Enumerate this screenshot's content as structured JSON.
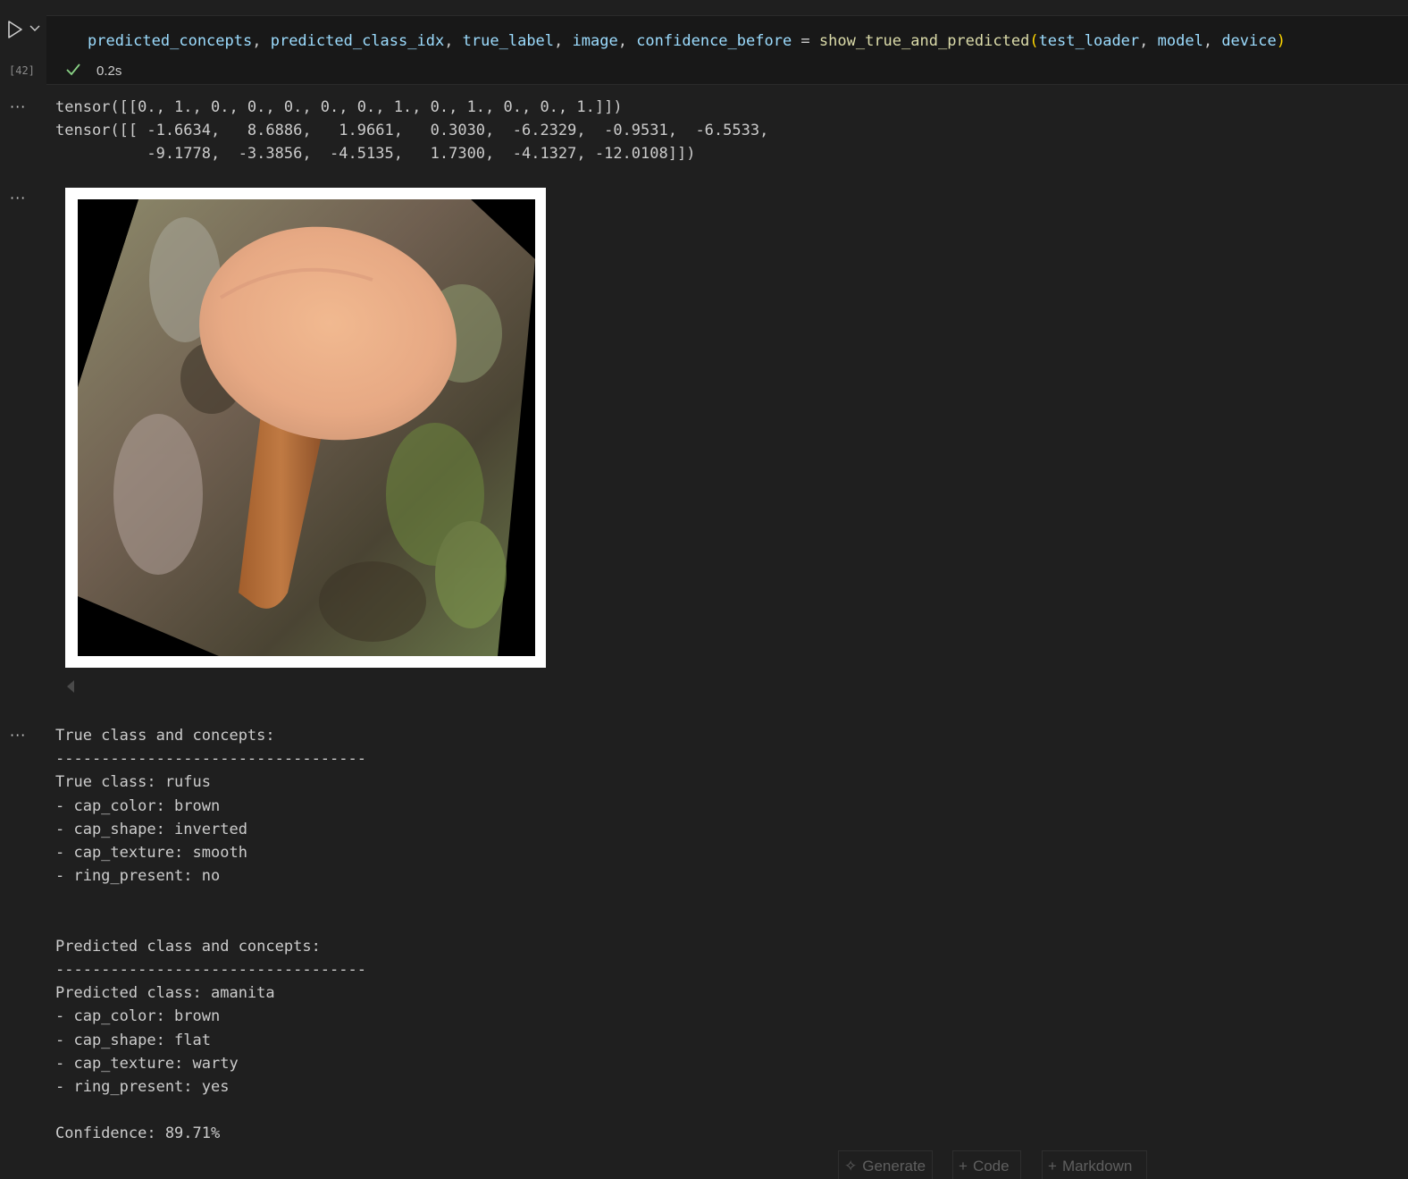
{
  "cell": {
    "execution_count": "[42]",
    "status_time": "0.2s",
    "code_tokens": [
      {
        "t": "predicted_concepts",
        "c": "var"
      },
      {
        "t": ", ",
        "c": "punc"
      },
      {
        "t": "predicted_class_idx",
        "c": "var"
      },
      {
        "t": ", ",
        "c": "punc"
      },
      {
        "t": "true_label",
        "c": "var"
      },
      {
        "t": ", ",
        "c": "punc"
      },
      {
        "t": "image",
        "c": "var"
      },
      {
        "t": ", ",
        "c": "punc"
      },
      {
        "t": "confidence_before",
        "c": "var"
      },
      {
        "t": " = ",
        "c": "punc"
      },
      {
        "t": "show_true_and_predicted",
        "c": "fn"
      },
      {
        "t": "(",
        "c": "paren"
      },
      {
        "t": "test_loader",
        "c": "var"
      },
      {
        "t": ", ",
        "c": "punc"
      },
      {
        "t": "model",
        "c": "var"
      },
      {
        "t": ", ",
        "c": "punc"
      },
      {
        "t": "device",
        "c": "var"
      },
      {
        "t": ")",
        "c": "paren"
      }
    ]
  },
  "outputs": {
    "ellipsis": "···",
    "tensor_text": "tensor([[0., 1., 0., 0., 0., 0., 0., 1., 0., 1., 0., 0., 1.]])\ntensor([[ -1.6634,   8.6886,   1.9661,   0.3030,  -6.2329,  -0.9531,  -6.5533,\n          -9.1778,  -3.3856,  -4.5135,   1.7300,  -4.1327, -12.0108]])",
    "image_alt": "mushroom image",
    "report_text": "True class and concepts:\n----------------------------------\nTrue class: rufus\n- cap_color: brown\n- cap_shape: inverted\n- cap_texture: smooth\n- ring_present: no\n\n\nPredicted class and concepts:\n----------------------------------\nPredicted class: amanita\n- cap_color: brown\n- cap_shape: flat\n- cap_texture: warty\n- ring_present: yes\n\nConfidence: 89.71%"
  },
  "toolbar": {
    "generate_label": "Generate",
    "code_label": "Code",
    "markdown_label": "Markdown"
  },
  "colors": {
    "background": "#1f1f1f",
    "code_cell_bg": "#181818",
    "variable": "#9cdcfe",
    "function": "#dcdcaa",
    "bracket": "#ffd700",
    "success": "#89d185"
  }
}
